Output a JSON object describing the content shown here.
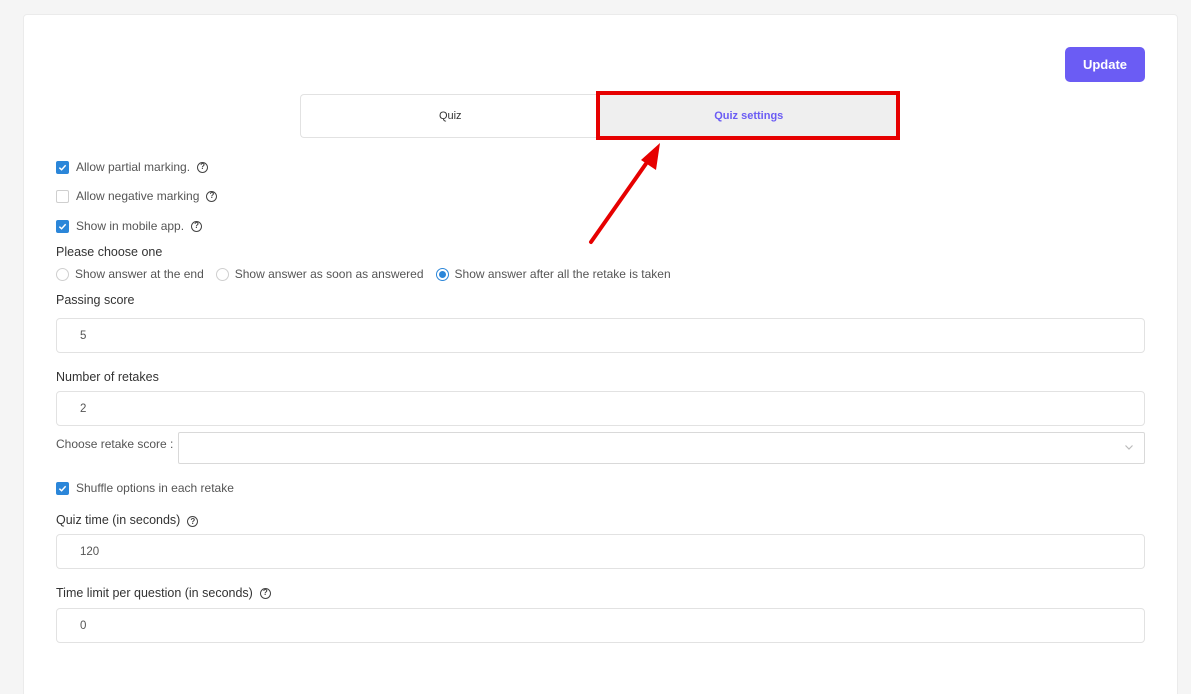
{
  "header": {
    "update_label": "Update"
  },
  "tabs": [
    {
      "label": "Quiz"
    },
    {
      "label": "Quiz settings"
    }
  ],
  "options": {
    "partial_marking": {
      "label": "Allow partial marking.",
      "checked": true
    },
    "negative_marking": {
      "label": "Allow negative marking",
      "checked": false
    },
    "mobile_app": {
      "label": "Show in mobile app.",
      "checked": true
    },
    "shuffle": {
      "label": "Shuffle options in each retake",
      "checked": true
    }
  },
  "answer_choice": {
    "label": "Please choose one",
    "options": [
      {
        "label": "Show answer at the end",
        "selected": false
      },
      {
        "label": "Show answer as soon as answered",
        "selected": false
      },
      {
        "label": "Show answer after all the retake is taken",
        "selected": true
      }
    ]
  },
  "fields": {
    "passing_score": {
      "label": "Passing score",
      "value": "5"
    },
    "retakes": {
      "label": "Number of retakes",
      "value": "2"
    },
    "retake_score": {
      "label": "Choose retake score :",
      "value": ""
    },
    "quiz_time": {
      "label": "Quiz time (in seconds)",
      "value": "120"
    },
    "time_limit": {
      "label": "Time limit per question (in seconds)",
      "value": "0"
    }
  },
  "help_glyph": "?",
  "colors": {
    "accent": "#6b5cf4",
    "checkbox": "#2b86d9",
    "annotation": "#e60000"
  }
}
